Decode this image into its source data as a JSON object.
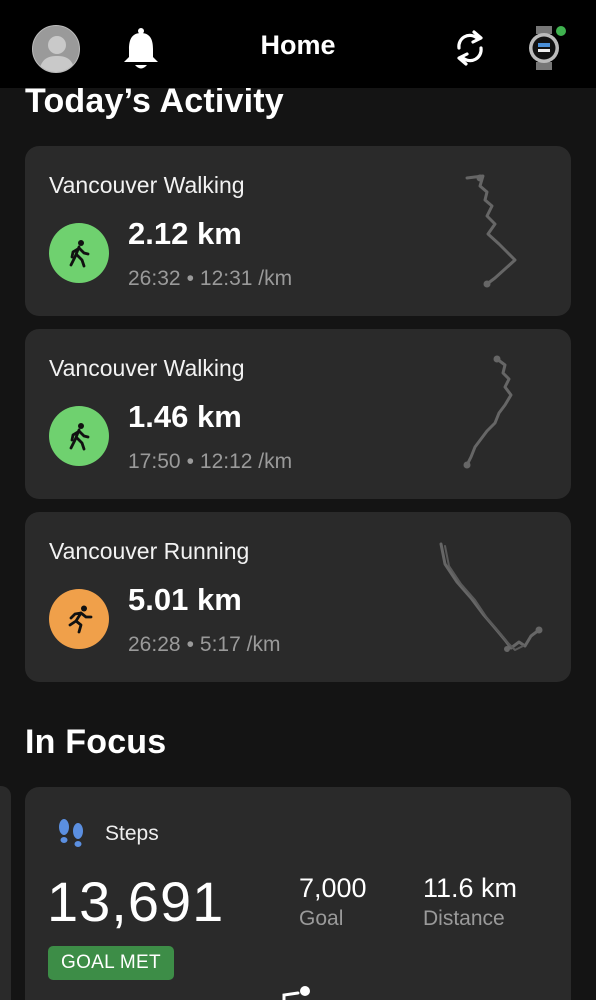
{
  "header": {
    "title": "Home",
    "watch_status_color": "#3fb24f",
    "icons": [
      "avatar",
      "bell-icon",
      "sync-icon",
      "watch-icon"
    ]
  },
  "today": {
    "title": "Today’s Activity",
    "activities": [
      {
        "name": "Vancouver Walking",
        "type": "walk",
        "distance": "2.12 km",
        "time": "26:32",
        "pace": "12:31 /km"
      },
      {
        "name": "Vancouver Walking",
        "type": "walk",
        "distance": "1.46 km",
        "time": "17:50",
        "pace": "12:12 /km"
      },
      {
        "name": "Vancouver Running",
        "type": "run",
        "distance": "5.01 km",
        "time": "26:28",
        "pace": "5:17 /km"
      }
    ],
    "separator": "•"
  },
  "focus": {
    "title": "In Focus",
    "steps": {
      "label": "Steps",
      "value": "13,691",
      "goal_value": "7,000",
      "goal_label": "Goal",
      "distance_value": "11.6 km",
      "distance_label": "Distance",
      "badge": "GOAL MET"
    }
  },
  "colors": {
    "walk": "#6fd16f",
    "run": "#f0a04a",
    "goal_met": "#3d8d47",
    "card": "#2a2a2a"
  }
}
